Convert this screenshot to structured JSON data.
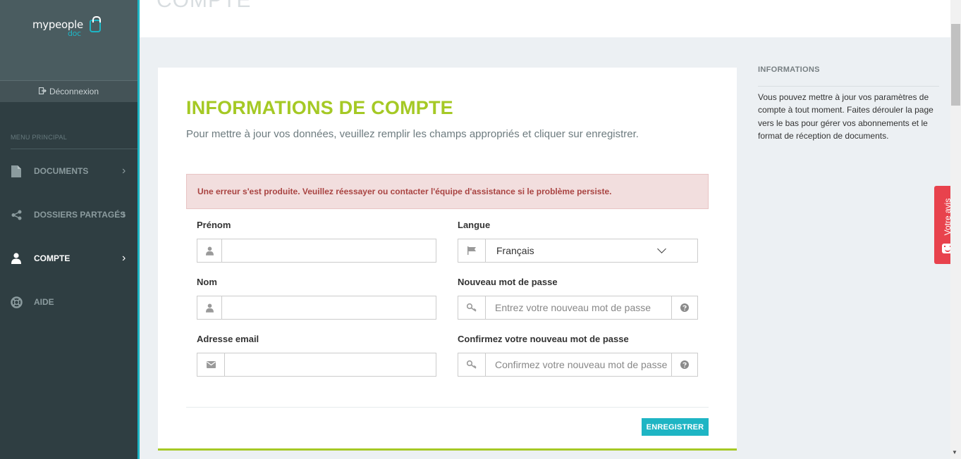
{
  "sidebar": {
    "logo_text": "mypeople",
    "logo_sub": "doc",
    "logout_label": "Déconnexion",
    "menu_title": "MENU PRINCIPAL",
    "items": [
      {
        "label": "DOCUMENTS",
        "icon": "document-icon",
        "active": false
      },
      {
        "label": "DOSSIERS PARTAGÉS",
        "icon": "share-icon",
        "active": false
      },
      {
        "label": "COMPTE",
        "icon": "user-icon",
        "active": true
      },
      {
        "label": "AIDE",
        "icon": "lifebuoy-icon",
        "active": false
      }
    ]
  },
  "header": {
    "title": "COMPTE"
  },
  "form": {
    "title": "INFORMATIONS DE COMPTE",
    "subtitle": "Pour mettre à jour vos données, veuillez remplir les champs appropriés et cliquer sur enregistrer.",
    "error": "Une erreur s'est produite. Veuillez réessayer ou contacter l'équipe d'assistance si le problème persiste.",
    "first_name": {
      "label": "Prénom",
      "value": ""
    },
    "last_name": {
      "label": "Nom",
      "value": ""
    },
    "email": {
      "label": "Adresse email",
      "value": ""
    },
    "language": {
      "label": "Langue",
      "value": "Français"
    },
    "new_password": {
      "label": "Nouveau mot de passe",
      "placeholder": "Entrez votre nouveau mot de passe"
    },
    "confirm_password": {
      "label": "Confirmez votre nouveau mot de passe",
      "placeholder": "Confirmez votre nouveau mot de passe"
    },
    "save_label": "ENREGISTRER"
  },
  "info_panel": {
    "title": "INFORMATIONS",
    "text": "Vous pouvez mettre à jour vos paramètres de compte à tout moment. Faites dérouler la page vers le bas pour gérer vos abonnements et le format de réception de documents."
  },
  "feedback": {
    "label": "Votre avis"
  },
  "colors": {
    "accent_green": "#a5c925",
    "accent_teal": "#1eb5c4",
    "sidebar_bg": "#2f3e42",
    "error_text": "#a94442",
    "feedback_red": "#e8424d"
  }
}
